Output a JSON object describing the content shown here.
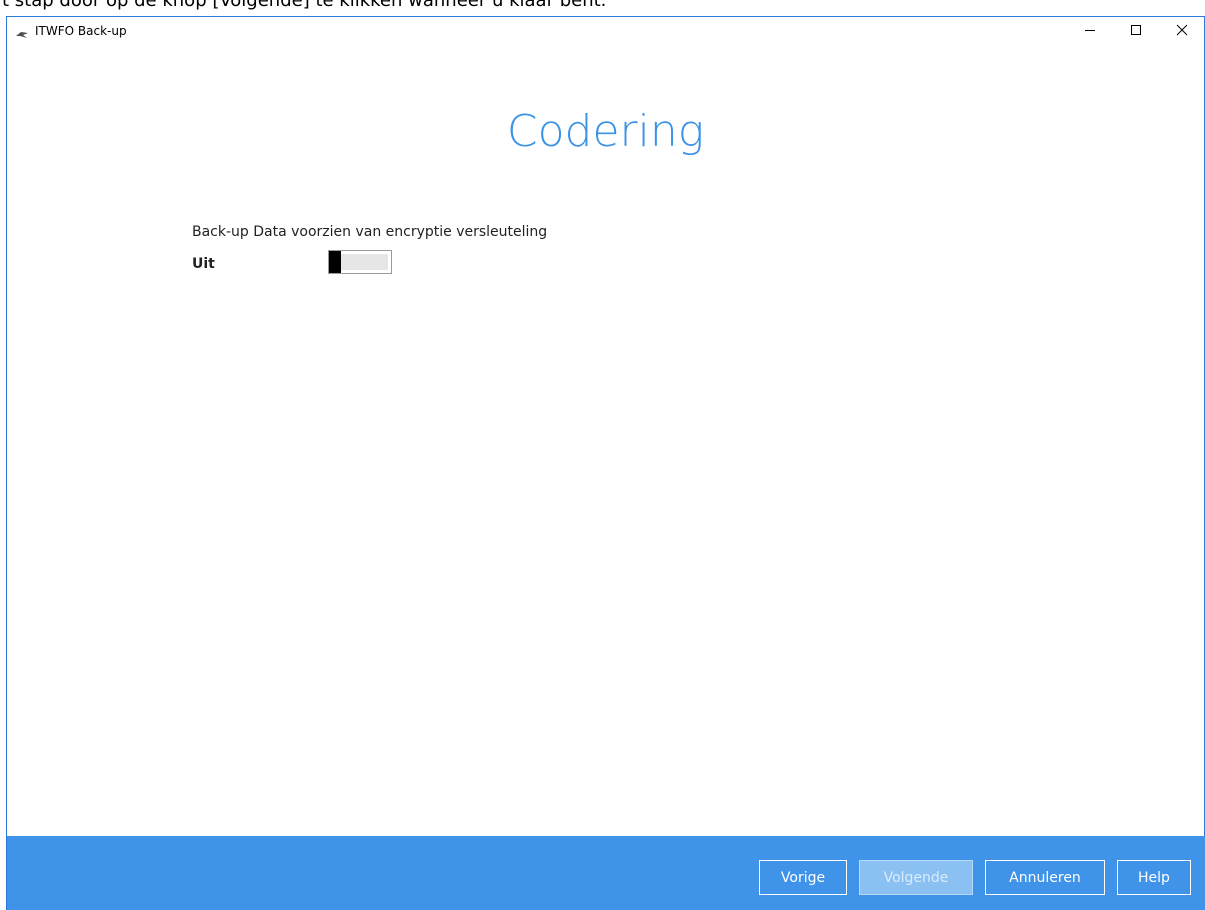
{
  "doc_header": {
    "text": "t stap door op de knop [Volgende] te klikken wanneer u klaar bent."
  },
  "window": {
    "title": "ITWFO Back-up",
    "icon": "app-logo-icon",
    "controls": {
      "minimize": "minimize-icon",
      "maximize": "maximize-icon",
      "close": "close-icon"
    }
  },
  "main": {
    "heading": "Codering",
    "option_label": "Back-up Data voorzien van encryptie versleuteling",
    "toggle": {
      "state_label": "Uit",
      "on": false
    }
  },
  "footer": {
    "buttons": [
      {
        "label": "Vorige",
        "enabled": true
      },
      {
        "label": "Volgende",
        "enabled": false
      },
      {
        "label": "Annuleren",
        "enabled": true
      },
      {
        "label": "Help",
        "enabled": true
      }
    ]
  },
  "colors": {
    "accent": "#3a93e6",
    "footer": "#3f93e9",
    "window_border": "#2b79d8"
  }
}
